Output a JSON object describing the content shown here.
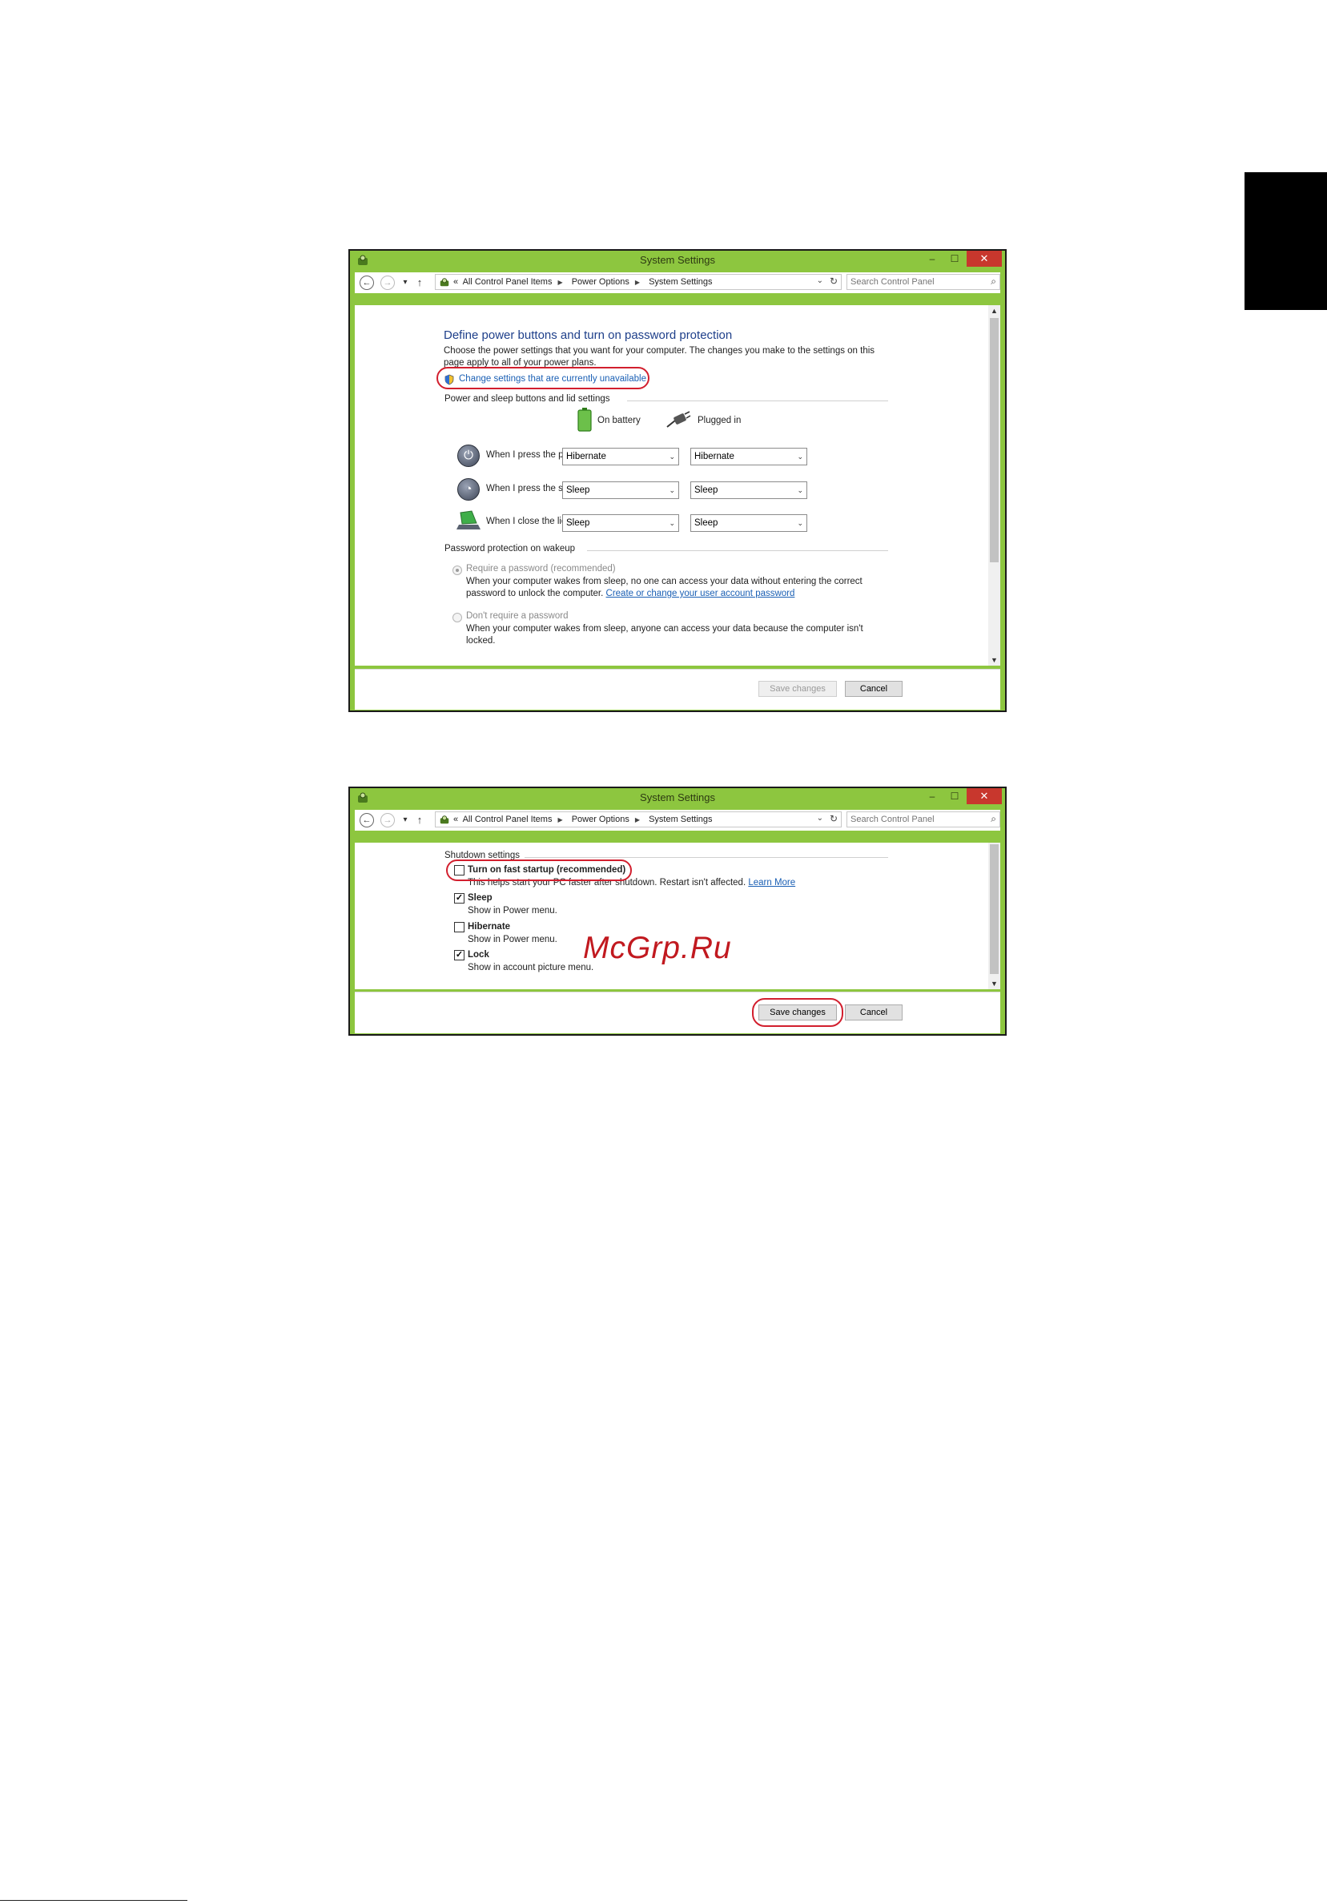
{
  "watermark": "McGrp.Ru",
  "window1": {
    "title": "System Settings",
    "controls": {
      "minimize": "–",
      "maximize": "☐",
      "close": "✕"
    },
    "nav": {
      "back": "←",
      "forward": "→",
      "recent": "▾",
      "up": "↑",
      "breadcrumb": [
        "«",
        "All Control Panel Items",
        "Power Options",
        "System Settings"
      ],
      "search_placeholder": "Search Control Panel"
    },
    "heading": "Define power buttons and turn on password protection",
    "description": "Choose the power settings that you want for your computer. The changes you make to the settings on this page apply to all of your power plans.",
    "change_settings_link": "Change settings that are currently unavailable",
    "power_section_label": "Power and sleep buttons and lid settings",
    "columns": {
      "on_battery": "On battery",
      "plugged_in": "Plugged in"
    },
    "rows": [
      {
        "label": "When I press the power button:",
        "on_battery": "Hibernate",
        "plugged_in": "Hibernate"
      },
      {
        "label": "When I press the sleep button:",
        "on_battery": "Sleep",
        "plugged_in": "Sleep"
      },
      {
        "label": "When I close the lid:",
        "on_battery": "Sleep",
        "plugged_in": "Sleep"
      }
    ],
    "password_section_label": "Password protection on wakeup",
    "require_password": {
      "label": "Require a password (recommended)",
      "desc": "When your computer wakes from sleep, no one can access your data without entering the correct password to unlock the computer.",
      "link": "Create or change your user account password",
      "selected": true
    },
    "no_password": {
      "label": "Don't require a password",
      "desc": "When your computer wakes from sleep, anyone can access your data because the computer isn't locked.",
      "selected": false
    },
    "save_button": "Save changes",
    "cancel_button": "Cancel"
  },
  "window2": {
    "title": "System Settings",
    "controls": {
      "minimize": "–",
      "maximize": "☐",
      "close": "✕"
    },
    "nav": {
      "back": "←",
      "forward": "→",
      "recent": "▾",
      "up": "↑",
      "breadcrumb": [
        "«",
        "All Control Panel Items",
        "Power Options",
        "System Settings"
      ],
      "search_placeholder": "Search Control Panel"
    },
    "section_label": "Shutdown settings",
    "options": [
      {
        "label": "Turn on fast startup (recommended)",
        "desc": "This helps start your PC faster after shutdown. Restart isn't affected.",
        "link": "Learn More",
        "checked": false
      },
      {
        "label": "Sleep",
        "desc": "Show in Power menu.",
        "checked": true
      },
      {
        "label": "Hibernate",
        "desc": "Show in Power menu.",
        "checked": false
      },
      {
        "label": "Lock",
        "desc": "Show in account picture menu.",
        "checked": true
      }
    ],
    "save_button": "Save changes",
    "cancel_button": "Cancel"
  },
  "colors": {
    "window_frame": "#8dc63f",
    "highlight_oval": "#d21f2e",
    "heading_blue": "#1e3f8a",
    "link_blue": "#1a5fb4",
    "side_tab": "#000000"
  },
  "icons": [
    "control-panel-icon",
    "shield-icon",
    "battery-icon",
    "plug-icon",
    "power-button-icon",
    "sleep-button-icon",
    "laptop-lid-icon",
    "search-icon"
  ]
}
